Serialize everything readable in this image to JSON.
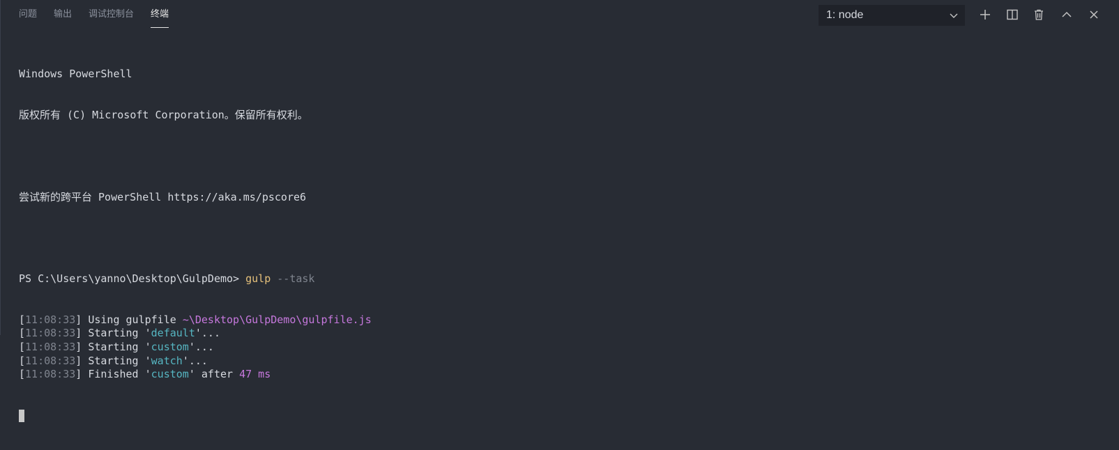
{
  "tabs": [
    {
      "label": "问题",
      "active": false
    },
    {
      "label": "输出",
      "active": false
    },
    {
      "label": "调试控制台",
      "active": false
    },
    {
      "label": "终端",
      "active": true
    }
  ],
  "terminal_select": {
    "selected": "1: node"
  },
  "toolbar": {
    "icons": [
      "plus-icon",
      "split-terminal-icon",
      "trash-icon",
      "chevron-up-icon",
      "close-icon"
    ]
  },
  "terminal": {
    "header1": "Windows PowerShell",
    "header2": "版权所有 (C) Microsoft Corporation。保留所有权利。",
    "header3": "尝试新的跨平台 PowerShell https://aka.ms/pscore6",
    "prompt": "PS C:\\Users\\yanno\\Desktop\\GulpDemo> ",
    "command": "gulp",
    "command_args": " --task",
    "logs": [
      {
        "time": "11:08:33",
        "pre": "Using gulpfile ",
        "hl": "~\\Desktop\\GulpDemo\\gulpfile.js",
        "hl_color": "magenta",
        "post": ""
      },
      {
        "time": "11:08:33",
        "pre": "Starting '",
        "hl": "default",
        "hl_color": "cyan",
        "post": "'..."
      },
      {
        "time": "11:08:33",
        "pre": "Starting '",
        "hl": "custom",
        "hl_color": "cyan",
        "post": "'..."
      },
      {
        "time": "11:08:33",
        "pre": "Starting '",
        "hl": "watch",
        "hl_color": "cyan",
        "post": "'..."
      },
      {
        "time": "11:08:33",
        "pre": "Finished '",
        "hl": "custom",
        "hl_color": "cyan",
        "post": "' after ",
        "tail": "47 ms"
      }
    ]
  },
  "colors": {
    "background": "#282c34",
    "text": "#d7dae0",
    "time": "#7f848e",
    "command": "#e5c07b",
    "path": "#c678dd",
    "task": "#56b6c2"
  }
}
